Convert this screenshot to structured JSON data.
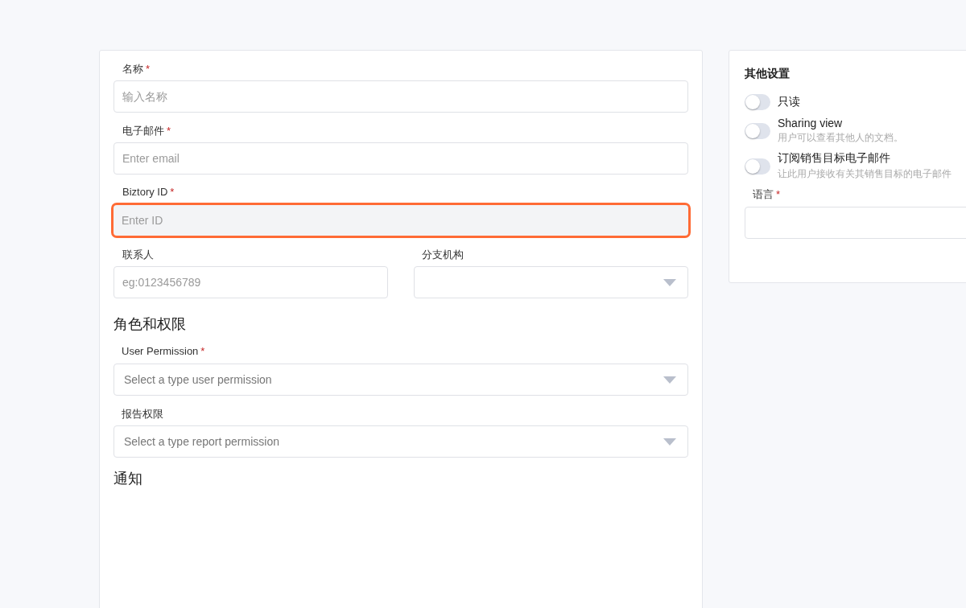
{
  "form": {
    "items": [
      {
        "kind": "text",
        "label": "名称",
        "mark": "*",
        "placeholder": "输入名称",
        "highlighted": false
      },
      {
        "kind": "text",
        "label": "电子邮件",
        "mark": "*",
        "placeholder": "Enter email",
        "highlighted": false
      },
      {
        "kind": "text",
        "label": "Biztory ID",
        "mark": "*",
        "placeholder": "Enter ID",
        "highlighted": true
      },
      {
        "kind": "row",
        "children": [
          {
            "kind": "text",
            "label": "联系人",
            "placeholder": "eg:0123456789",
            "highlighted": false
          },
          {
            "kind": "select",
            "label": "分支机构"
          }
        ]
      },
      {
        "kind": "heading",
        "text": "角色和权限"
      },
      {
        "kind": "select",
        "label": "User Permission",
        "mark": "*",
        "placeholder": "Select a type user permission"
      },
      {
        "kind": "select",
        "label": "报告权限",
        "placeholder": "Select a type report permission"
      },
      {
        "kind": "heading",
        "text": "通知"
      }
    ]
  },
  "other_settings": {
    "title": "其他设置",
    "toggles": [
      {
        "label": "只读",
        "on": false
      },
      {
        "label": "Sharing view",
        "description": "用户可以查看其他人的文档。",
        "on": false
      },
      {
        "label": "订阅销售目标电子邮件",
        "description": "让此用户接收有关其销售目标的电子邮件",
        "on": false
      }
    ],
    "language": {
      "label": "语言",
      "mark": "*"
    }
  }
}
